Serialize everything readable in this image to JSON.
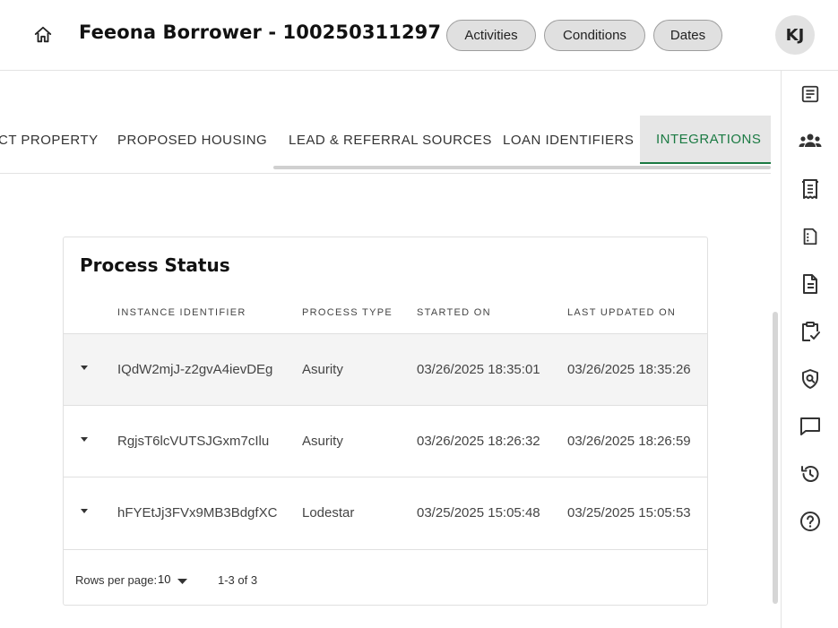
{
  "header": {
    "title": "Feeona Borrower - 100250311297",
    "pills": [
      "Activities",
      "Conditions",
      "Dates"
    ],
    "avatar_initials": "KJ"
  },
  "tabs": [
    {
      "label": "CT PROPERTY",
      "active": false
    },
    {
      "label": "PROPOSED HOUSING",
      "active": false
    },
    {
      "label": "LEAD & REFERRAL SOURCES",
      "active": false
    },
    {
      "label": "LOAN IDENTIFIERS",
      "active": false
    },
    {
      "label": "INTEGRATIONS",
      "active": true
    }
  ],
  "process_status": {
    "title": "Process Status",
    "columns": [
      "INSTANCE IDENTIFIER",
      "PROCESS TYPE",
      "STARTED ON",
      "LAST UPDATED ON"
    ],
    "rows": [
      {
        "instance": "IQdW2mjJ-z2gvA4ievDEg",
        "type": "Asurity",
        "started": "03/26/2025 18:35:01",
        "updated": "03/26/2025 18:35:26"
      },
      {
        "instance": "RgjsT6lcVUTSJGxm7cIlu",
        "type": "Asurity",
        "started": "03/26/2025 18:26:32",
        "updated": "03/26/2025 18:26:59"
      },
      {
        "instance": "hFYEtJj3FVx9MB3BdgfXC",
        "type": "Lodestar",
        "started": "03/25/2025 15:05:48",
        "updated": "03/25/2025 15:05:53"
      }
    ],
    "footer": {
      "rows_per_page_label": "Rows per page:",
      "rows_per_page_value": "10",
      "range": "1-3 of 3"
    }
  },
  "rail_icons": [
    "notes-icon",
    "people-icon",
    "receipt-icon",
    "document-outline-icon",
    "document-text-icon",
    "clipboard-check-icon",
    "shield-search-icon",
    "chat-icon",
    "history-icon",
    "help-icon"
  ],
  "colors": {
    "accent": "#1b7a43",
    "pill_bg": "#e0e0e0",
    "active_tab_bg": "#e6e6e6"
  }
}
